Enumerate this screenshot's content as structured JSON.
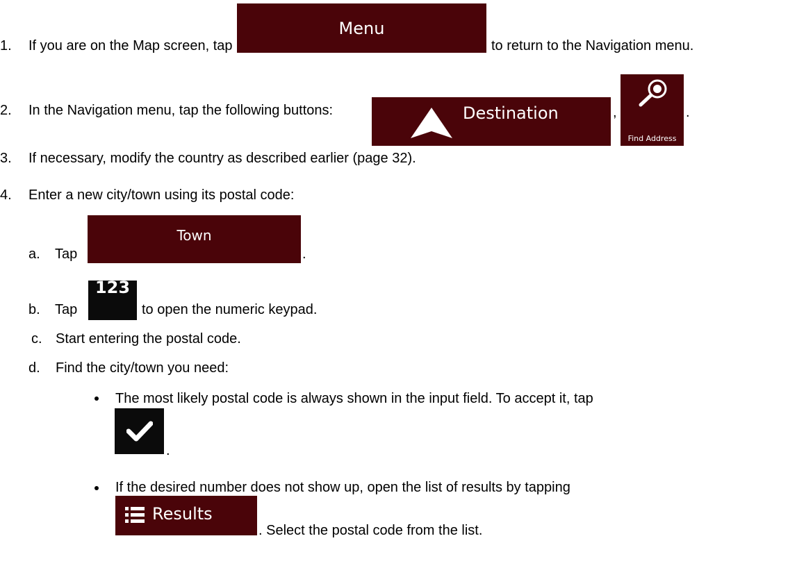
{
  "steps": [
    {
      "num": "1.",
      "before": "If you are on the Map screen, tap",
      "after": "to return to the Navigation menu."
    },
    {
      "num": "2.",
      "text": "In the Navigation menu, tap the following buttons:",
      "comma": ",",
      "period": "."
    },
    {
      "num": "3.",
      "text": "If necessary, modify the country as described earlier (page 32)."
    },
    {
      "num": "4.",
      "text": "Enter a new city/town using its postal code:"
    }
  ],
  "substeps": {
    "a": {
      "letter": "a.",
      "before": "Tap",
      "after": "."
    },
    "b": {
      "letter": "b.",
      "before": "Tap",
      "after": "to open the numeric keypad."
    },
    "c": {
      "letter": "c.",
      "text": "Start entering the postal code."
    },
    "d": {
      "letter": "d.",
      "text": "Find the city/town you need:"
    }
  },
  "bullets": [
    {
      "text": "The most likely postal code is always shown in the input field. To accept it, tap",
      "after": "."
    },
    {
      "before": "If the desired number does not show up, open the list of results by tapping",
      "after": ". Select the postal code from the list."
    }
  ],
  "buttons": {
    "menu": "Menu",
    "destination": "Destination",
    "find_address": "Find Address",
    "town": "Town",
    "numeric": "123",
    "results": "Results"
  },
  "icons": {
    "destination": "navigation-arrow-icon",
    "find_address": "magnifier-icon",
    "accept": "checkmark-icon",
    "results": "list-icon"
  },
  "colors": {
    "button_bg": "#4a0409",
    "dark_button_bg": "#0b0b0b",
    "button_text": "#ffffff"
  }
}
